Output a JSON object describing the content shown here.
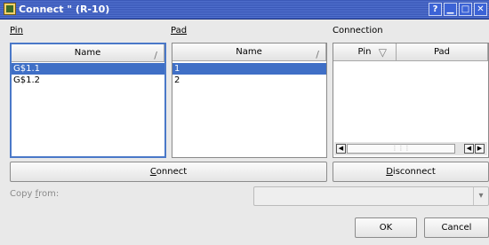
{
  "window": {
    "title": "Connect \" (R-10)",
    "buttons": {
      "help": "?",
      "minimize": "▁",
      "maximize": "□",
      "close": "✕"
    }
  },
  "labels": {
    "pin": "Pin",
    "pad": "Pad",
    "connection": "Connection",
    "copy_from": "Copy from:"
  },
  "pin_list": {
    "header": "Name",
    "sort_indicator": "/",
    "items": [
      "G$1.1",
      "G$1.2"
    ],
    "selected_index": 0
  },
  "pad_list": {
    "header": "Name",
    "sort_indicator": "/",
    "items": [
      "1",
      "2"
    ],
    "selected_index": 0
  },
  "connection_table": {
    "columns": [
      "Pin",
      "Pad"
    ],
    "sort_indicator": "▽",
    "rows": []
  },
  "buttons": {
    "connect": "Connect",
    "disconnect": "Disconnect",
    "ok": "OK",
    "cancel": "Cancel"
  },
  "copy_from": {
    "value": ""
  },
  "icons": {
    "app": "app-icon",
    "combo_arrow": "▾",
    "scroll_left": "◀",
    "scroll_right": "▶",
    "scroll_thumb_grip": "⋮⋮⋮"
  }
}
